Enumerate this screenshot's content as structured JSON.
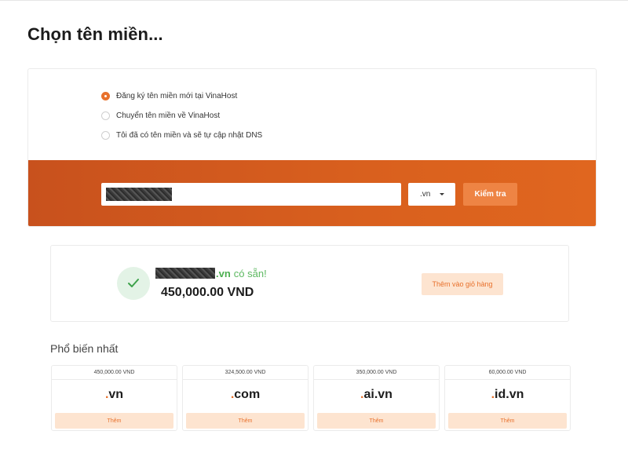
{
  "page": {
    "title": "Chọn tên miền..."
  },
  "options": [
    {
      "label": "Đăng ký tên miền mới tại VinaHost",
      "checked": true
    },
    {
      "label": "Chuyển tên miền về VinaHost",
      "checked": false
    },
    {
      "label": "Tôi đã có tên miền và sẽ tự cập nhật DNS",
      "checked": false
    }
  ],
  "search": {
    "value": "",
    "tld": ".vn",
    "button_label": "Kiểm tra"
  },
  "result": {
    "tld": ".vn",
    "status_text": "có sẵn!",
    "price": "450,000.00 VND",
    "add_label": "Thêm vào giỏ hàng"
  },
  "popular": {
    "heading": "Phổ biến nhất",
    "items": [
      {
        "price": "450,000.00 VND",
        "tld_dot": ".",
        "tld_name": "vn",
        "add_label": "Thêm"
      },
      {
        "price": "324,500.00 VND",
        "tld_dot": ".",
        "tld_name": "com",
        "add_label": "Thêm"
      },
      {
        "price": "350,000.00 VND",
        "tld_dot": ".",
        "tld_name": "ai.vn",
        "add_label": "Thêm"
      },
      {
        "price": "60,000.00 VND",
        "tld_dot": ".",
        "tld_name": "id.vn",
        "add_label": "Thêm"
      }
    ]
  },
  "colors": {
    "accent": "#e8712c",
    "band": "#d35a1e",
    "success": "#4caf50",
    "soft_accent": "#fde4d0"
  },
  "icons": {
    "available": "checkmark-icon",
    "dropdown": "caret-down-icon"
  }
}
